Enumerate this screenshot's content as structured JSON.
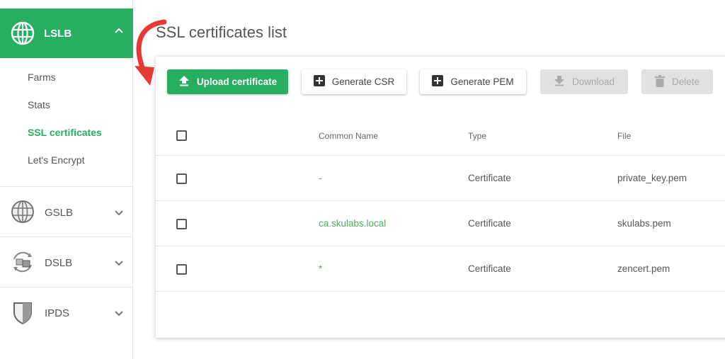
{
  "page_title": "SSL certificates list",
  "sidebar": {
    "active_module": {
      "label": "LSLB",
      "icon": "globe-network-icon"
    },
    "submenu": [
      {
        "label": "Farms",
        "active": false
      },
      {
        "label": "Stats",
        "active": false
      },
      {
        "label": "SSL certificates",
        "active": true
      },
      {
        "label": "Let's Encrypt",
        "active": false
      }
    ],
    "modules": [
      {
        "label": "GSLB",
        "icon": "globe-icon"
      },
      {
        "label": "DSLB",
        "icon": "sync-boxes-icon"
      },
      {
        "label": "IPDS",
        "icon": "shield-icon"
      }
    ]
  },
  "toolbar": {
    "upload_label": "Upload certificate",
    "generate_csr_label": "Generate CSR",
    "generate_pem_label": "Generate PEM",
    "download_label": "Download",
    "delete_label": "Delete"
  },
  "table": {
    "columns": [
      "Common Name",
      "Type",
      "File"
    ],
    "rows": [
      {
        "common_name": "-",
        "type": "Certificate",
        "file": "private_key.pem"
      },
      {
        "common_name": "ca.skulabs.local",
        "type": "Certificate",
        "file": "skulabs.pem"
      },
      {
        "common_name": "*",
        "type": "Certificate",
        "file": "zencert.pem"
      }
    ]
  },
  "colors": {
    "accent": "#27ae60",
    "annotation_arrow": "#e53935",
    "disabled": "#e1e1e1"
  }
}
